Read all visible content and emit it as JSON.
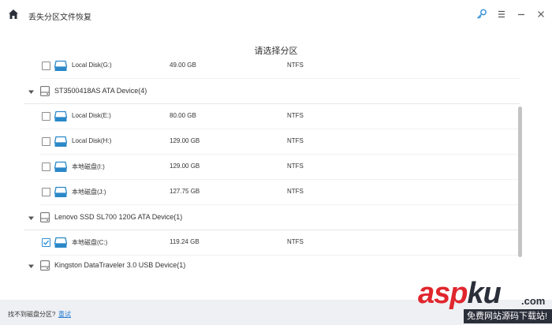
{
  "app": {
    "title": "丢失分区文件恢复"
  },
  "main": {
    "subtitle": "请选择分区"
  },
  "items": [
    {
      "kind": "partition",
      "name": "Local Disk(G:)",
      "size": "49.00 GB",
      "fs": "NTFS",
      "checked": false
    },
    {
      "kind": "device",
      "name": "ST3500418AS ATA Device(4)"
    },
    {
      "kind": "partition",
      "name": "Local Disk(E:)",
      "size": "80.00 GB",
      "fs": "NTFS",
      "checked": false
    },
    {
      "kind": "partition",
      "name": "Local Disk(H:)",
      "size": "129.00 GB",
      "fs": "NTFS",
      "checked": false
    },
    {
      "kind": "partition",
      "name": "本地磁盘(I:)",
      "size": "129.00 GB",
      "fs": "NTFS",
      "checked": false
    },
    {
      "kind": "partition",
      "name": "本地磁盘(J:)",
      "size": "127.75 GB",
      "fs": "NTFS",
      "checked": false
    },
    {
      "kind": "device",
      "name": "Lenovo SSD SL700 120G ATA Device(1)"
    },
    {
      "kind": "partition",
      "name": "本地磁盘(C:)",
      "size": "119.24 GB",
      "fs": "NTFS",
      "checked": true
    },
    {
      "kind": "device",
      "name": "Kingston DataTraveler 3.0 USB Device(1)"
    }
  ],
  "footer": {
    "question": "找不到磁盘分区?",
    "retry": "重试"
  },
  "watermark": {
    "main_red": "asp",
    "main_dark": "ku",
    "suffix": ".com",
    "sub": "免费网站源码下载站!"
  },
  "colors": {
    "accent": "#2f8fd8",
    "disk_icon": "#2b88c8",
    "footer_bg": "#eef0f3",
    "watermark_red": "#e0262d"
  }
}
